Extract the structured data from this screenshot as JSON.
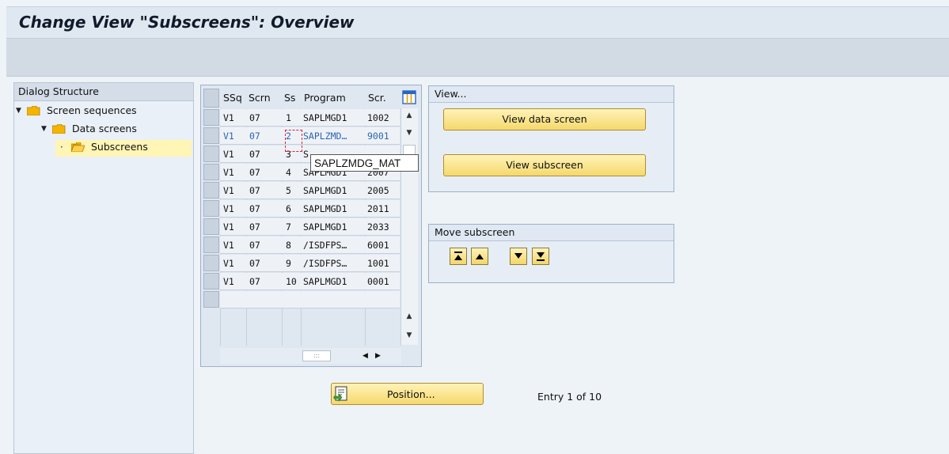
{
  "window": {
    "title": "Change View \"Subscreens\": Overview"
  },
  "dialog_structure": {
    "header": "Dialog Structure",
    "items": [
      {
        "label": "Screen sequences",
        "level": 0,
        "expanded": true
      },
      {
        "label": "Data screens",
        "level": 1,
        "expanded": true
      },
      {
        "label": "Subscreens",
        "level": 2,
        "selected": true
      }
    ]
  },
  "table": {
    "headers": [
      "SSq",
      "Scrn",
      "Ss",
      "Program",
      "Scr."
    ],
    "rows": [
      [
        "V1",
        "07",
        "1",
        "SAPLMGD1",
        "1002"
      ],
      [
        "V1",
        "07",
        "2",
        "SAPLZMD…",
        "9001"
      ],
      [
        "V1",
        "07",
        "3",
        "S",
        ""
      ],
      [
        "V1",
        "07",
        "4",
        "SAPLMGD1",
        "2007"
      ],
      [
        "V1",
        "07",
        "5",
        "SAPLMGD1",
        "2005"
      ],
      [
        "V1",
        "07",
        "6",
        "SAPLMGD1",
        "2011"
      ],
      [
        "V1",
        "07",
        "7",
        "SAPLMGD1",
        "2033"
      ],
      [
        "V1",
        "07",
        "8",
        "/ISDFPS…",
        "6001"
      ],
      [
        "V1",
        "07",
        "9",
        "/ISDFPS…",
        "1001"
      ],
      [
        "V1",
        "07",
        "10",
        "SAPLMGD1",
        "0001"
      ]
    ],
    "tooltip": "SAPLZMDG_MAT",
    "settings_icon": "table-settings-icon"
  },
  "view_group": {
    "title": "View...",
    "buttons": {
      "data_screen": "View data screen",
      "subscreen": "View subscreen"
    }
  },
  "move_group": {
    "title": "Move subscreen",
    "buttons": [
      "move-first-icon",
      "move-up-icon",
      "move-down-icon",
      "move-last-icon"
    ]
  },
  "position_button": {
    "label": "Position..."
  },
  "entry_info": "Entry 1 of 10",
  "colors": {
    "button_yellow": "#f5d86d",
    "selection": "#fff5b5",
    "link_blue": "#2b64b5"
  }
}
